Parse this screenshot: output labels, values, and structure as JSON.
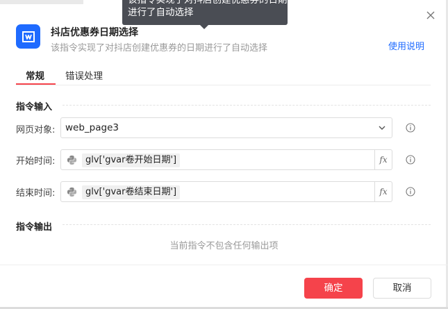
{
  "tooltip": {
    "line1": "该指令实现了对抖店创建优惠券的日期",
    "line2": "进行了自动选择"
  },
  "header": {
    "title": "抖店优惠券日期选择",
    "subtitle": "该指令实现了对抖店创建优惠券的日期进行了自动选择",
    "help_link": "使用说明"
  },
  "tabs": [
    {
      "label": "常规",
      "active": true
    },
    {
      "label": "错误处理",
      "active": false
    }
  ],
  "inputs_section": {
    "title": "指令输入",
    "fields": [
      {
        "label": "网页对象:",
        "type": "select",
        "value": "web_page3"
      },
      {
        "label": "开始时间:",
        "type": "expression",
        "value": "glv['gvar卷开始日期']",
        "fx_label": "fx"
      },
      {
        "label": "结束时间:",
        "type": "expression",
        "value": "glv['gvar卷结束日期']",
        "fx_label": "fx"
      }
    ]
  },
  "outputs_section": {
    "title": "指令输出",
    "empty_text": "当前指令不包含任何输出项"
  },
  "footer": {
    "confirm_label": "确定",
    "cancel_label": "取消"
  },
  "colors": {
    "accent": "#f5434b",
    "brand": "#1f6bff",
    "tooltip_bg": "#4a4d54"
  },
  "icons": {
    "app": "app-logo-icon",
    "close": "close-icon",
    "python": "python-icon",
    "info": "info-icon",
    "dropdown": "chevron-down-icon"
  }
}
